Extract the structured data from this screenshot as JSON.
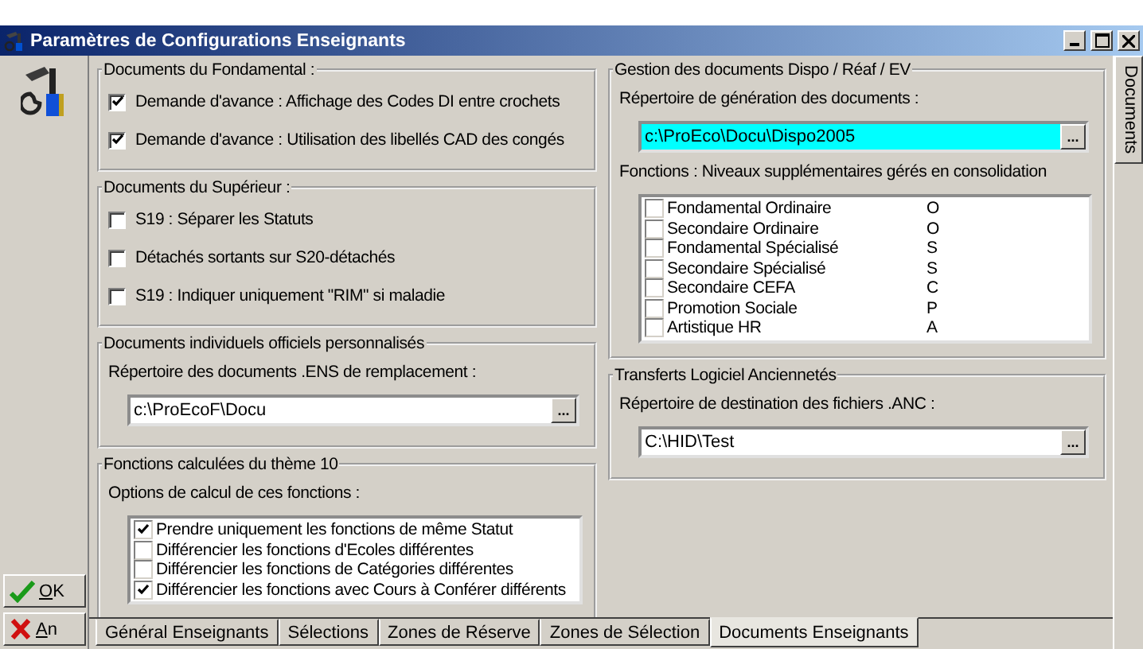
{
  "window": {
    "title": "Paramètres de Configurations Enseignants"
  },
  "actions": [
    {
      "label": "OK",
      "kind": "ok"
    },
    {
      "label": "An",
      "kind": "cancel"
    }
  ],
  "columns": [
    {
      "groups": [
        {
          "title": "Documents du Fondamental :",
          "content": [
            {
              "kind": "checkbox",
              "label": "Demande d'avance : Affichage des Codes DI entre crochets",
              "checked": true
            },
            {
              "kind": "checkbox",
              "label": "Demande d'avance : Utilisation des libellés CAD des congés",
              "checked": true
            }
          ]
        },
        {
          "title": "Documents du Supérieur :",
          "content": [
            {
              "kind": "checkbox",
              "label": "S19 : Séparer les Statuts",
              "checked": false
            },
            {
              "kind": "checkbox",
              "label": "Détachés sortants sur S20-détachés",
              "checked": false
            },
            {
              "kind": "checkbox",
              "label": "S19 : Indiquer uniquement \"RIM\" si maladie",
              "checked": false
            }
          ]
        },
        {
          "title": "Documents individuels officiels personnalisés",
          "content": [
            {
              "kind": "label",
              "text": "Répertoire des documents .ENS de remplacement :"
            },
            {
              "kind": "path",
              "value": "c:\\ProEcoF\\Docu",
              "highlighted": false,
              "button": "..."
            }
          ]
        },
        {
          "title": "Fonctions calculées du thème 10",
          "content": [
            {
              "kind": "label",
              "text": "Options de calcul de ces fonctions :"
            },
            {
              "kind": "checklist",
              "items": [
                {
                  "label": "Prendre uniquement les fonctions de même Statut",
                  "checked": true
                },
                {
                  "label": "Différencier les fonctions d'Ecoles différentes",
                  "checked": false
                },
                {
                  "label": "Différencier les fonctions de Catégories différentes",
                  "checked": false
                },
                {
                  "label": "Différencier les fonctions avec Cours à Conférer différents",
                  "checked": true
                }
              ]
            }
          ]
        }
      ]
    },
    {
      "groups": [
        {
          "title": "Gestion des documents Dispo / Réaf / EV",
          "content": [
            {
              "kind": "label",
              "text": "Répertoire de génération des documents :"
            },
            {
              "kind": "path",
              "value": "c:\\ProEco\\Docu\\Dispo2005",
              "highlighted": true,
              "button": "..."
            },
            {
              "kind": "label",
              "text": "Fonctions : Niveaux supplémentaires gérés en consolidation"
            },
            {
              "kind": "checklist",
              "items": [
                {
                  "label": "Fondamental Ordinaire",
                  "code": "O",
                  "checked": false
                },
                {
                  "label": "Secondaire Ordinaire",
                  "code": "O",
                  "checked": false
                },
                {
                  "label": "Fondamental Spécialisé",
                  "code": "S",
                  "checked": false
                },
                {
                  "label": "Secondaire Spécialisé",
                  "code": "S",
                  "checked": false
                },
                {
                  "label": "Secondaire CEFA",
                  "code": "C",
                  "checked": false
                },
                {
                  "label": "Promotion Sociale",
                  "code": "P",
                  "checked": false
                },
                {
                  "label": "Artistique HR",
                  "code": "A",
                  "checked": false
                }
              ]
            }
          ]
        },
        {
          "title": "Transferts Logiciel Anciennetés",
          "content": [
            {
              "kind": "label",
              "text": "Répertoire de destination des fichiers .ANC :"
            },
            {
              "kind": "path",
              "value": "C:\\HID\\Test",
              "highlighted": false,
              "button": "..."
            }
          ]
        }
      ]
    }
  ],
  "side_tab": {
    "label": "Documents"
  },
  "tabs": [
    {
      "label": "Général Enseignants",
      "selected": false
    },
    {
      "label": "Sélections",
      "selected": false
    },
    {
      "label": "Zones de Réserve",
      "selected": false
    },
    {
      "label": "Zones de Sélection",
      "selected": false
    },
    {
      "label": "Documents Enseignants",
      "selected": true
    }
  ]
}
